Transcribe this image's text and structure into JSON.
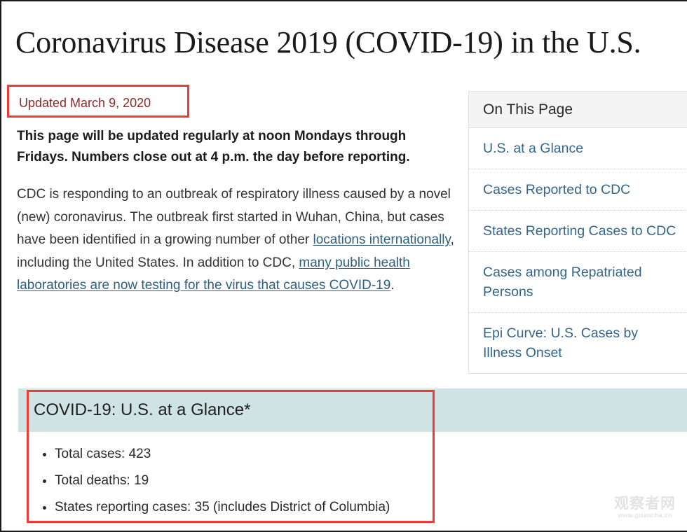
{
  "page": {
    "title": "Coronavirus Disease 2019 (COVID-19) in the U.S.",
    "updated": "Updated March 9, 2020",
    "lede": "This page will be updated regularly at noon Mondays through Fridays. Numbers close out at 4 p.m. the day before reporting.",
    "paragraph": {
      "part1": "CDC is responding to an outbreak of respiratory illness caused by a novel (new) coronavirus. The outbreak first started in Wuhan, China, but cases have been identified in a growing number of other ",
      "link1": "locations internationally",
      "part2": ", including the United States. In addition to CDC, ",
      "link2": "many public health laboratories are now testing for the virus that causes COVID-19",
      "part3": "."
    }
  },
  "on_this_page": {
    "header": "On This Page",
    "items": [
      {
        "label": "U.S. at a Glance"
      },
      {
        "label": "Cases Reported to CDC"
      },
      {
        "label": "States Reporting Cases to CDC"
      },
      {
        "label": "Cases among Repatriated Persons"
      },
      {
        "label": "Epi Curve: U.S. Cases by Illness Onset"
      }
    ]
  },
  "glance": {
    "title": "COVID-19: U.S. at a Glance*",
    "items": [
      "Total cases: 423",
      "Total deaths: 19",
      "States reporting cases: 35 (includes District of Columbia)"
    ]
  },
  "watermark": {
    "name": "观察者网",
    "url": "www.guancha.cn"
  },
  "colors": {
    "annotation_red": "#ee3b33",
    "updated_text": "#8a2b2b",
    "link_blue": "#2d5f82",
    "sidebar_link": "#35668a",
    "glance_band": "#cfe3e5",
    "sidebar_header": "#f4f4f4"
  }
}
